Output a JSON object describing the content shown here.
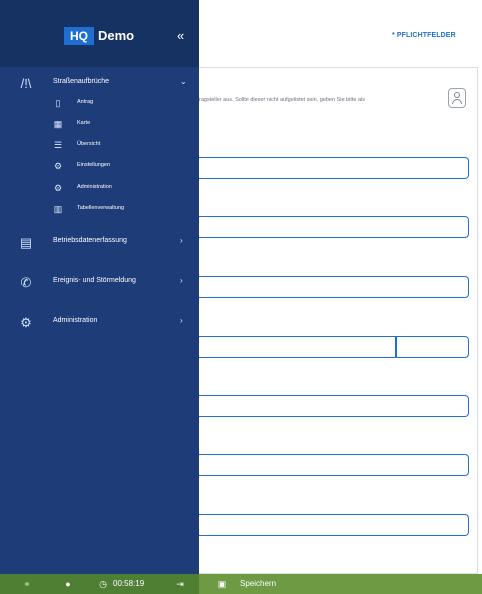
{
  "app": {
    "logo_badge": "HQ",
    "logo_text": "Demo",
    "collapse_symbol": "«"
  },
  "header": {
    "required_fields": "* PFLICHTFELDER"
  },
  "sidebar": {
    "groups": [
      {
        "label": "Straßenaufbrüche",
        "icon": "road-icon",
        "chevron": "⌄",
        "items": [
          {
            "label": "Antrag",
            "icon": "document-icon"
          },
          {
            "label": "Karte",
            "icon": "map-icon"
          },
          {
            "label": "Übersicht",
            "icon": "list-icon"
          },
          {
            "label": "Einstellungen",
            "icon": "gear-icon"
          },
          {
            "label": "Administration",
            "icon": "gears-icon"
          },
          {
            "label": "Tabellenverwaltung",
            "icon": "table-icon"
          }
        ]
      },
      {
        "label": "Betriebsdatenerfassung",
        "icon": "calendar-icon",
        "chevron": "›"
      },
      {
        "label": "Ereignis- und Störmeldung",
        "icon": "phone-icon",
        "chevron": "›"
      },
      {
        "label": "Administration",
        "icon": "gears-icon",
        "chevron": "›"
      }
    ]
  },
  "form": {
    "hint": "ragsteller aus. Sollte dieser nicht aufgelistet sein, geben Sie bitte als"
  },
  "footer": {
    "timer": "00:58:19",
    "save_label": "Speichern"
  },
  "colors": {
    "sidebar": "#1e3c78",
    "sidebar_top": "#163262",
    "accent": "#1f6fd1",
    "footer_green": "#6e9a44",
    "footer_dark_green": "#4f7f33"
  }
}
